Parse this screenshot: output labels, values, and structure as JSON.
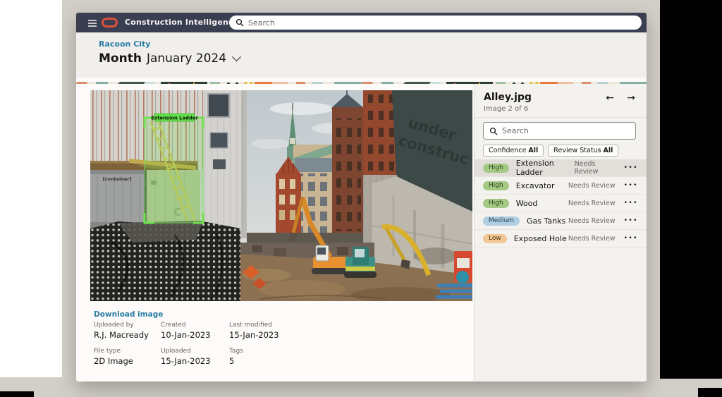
{
  "header": {
    "app_title": "Construction Intelligence Cloud",
    "search_placeholder": "Search",
    "bg": "#3A3E51",
    "logo_color": "#DD4F3E"
  },
  "subheader": {
    "breadcrumb": "Racoon City",
    "title_bold": "Month",
    "title_value": "January 2024"
  },
  "viewer": {
    "annotation_label": "Extension Ladder",
    "photo_texts": {
      "container_label": "[container]",
      "banner_line1": "under",
      "banner_line2": "construc"
    },
    "download_link": "Download image",
    "metadata": [
      {
        "label": "Uploaded by",
        "value": "R.J. Macready"
      },
      {
        "label": "Created",
        "value": "10-Jan-2023"
      },
      {
        "label": "Last modified",
        "value": "15-Jan-2023"
      },
      {
        "label": "File type",
        "value": "2D Image"
      },
      {
        "label": "Uploaded",
        "value": "15-Jan-2023"
      },
      {
        "label": "Tags",
        "value": "5"
      }
    ]
  },
  "panel": {
    "title": "Alley.jpg",
    "subtitle": "Image 2 of 6",
    "search_placeholder": "Search",
    "filters": [
      {
        "label": "Confidence",
        "value": "All"
      },
      {
        "label": "Review Status",
        "value": "All"
      }
    ],
    "detections": [
      {
        "confidence": "High",
        "label": "Extension Ladder",
        "status": "Needs Review",
        "selected": true
      },
      {
        "confidence": "High",
        "label": "Excavator",
        "status": "Needs Review",
        "selected": false
      },
      {
        "confidence": "High",
        "label": "Wood",
        "status": "Needs Review",
        "selected": false
      },
      {
        "confidence": "Medium",
        "label": "Gas Tanks",
        "status": "Needs Review",
        "selected": false
      },
      {
        "confidence": "Low",
        "label": "Exposed Hole",
        "status": "Needs Review",
        "selected": false
      }
    ],
    "confidence_colors": {
      "High": {
        "bg": "#A4CA85",
        "fg": "#33411D"
      },
      "Medium": {
        "bg": "#AFCEE0",
        "fg": "#1F3C50"
      },
      "Low": {
        "bg": "#F1C793",
        "fg": "#4E3A16"
      }
    }
  },
  "icons": {
    "arrow_left": "←",
    "arrow_right": "→",
    "overflow": "•••"
  }
}
